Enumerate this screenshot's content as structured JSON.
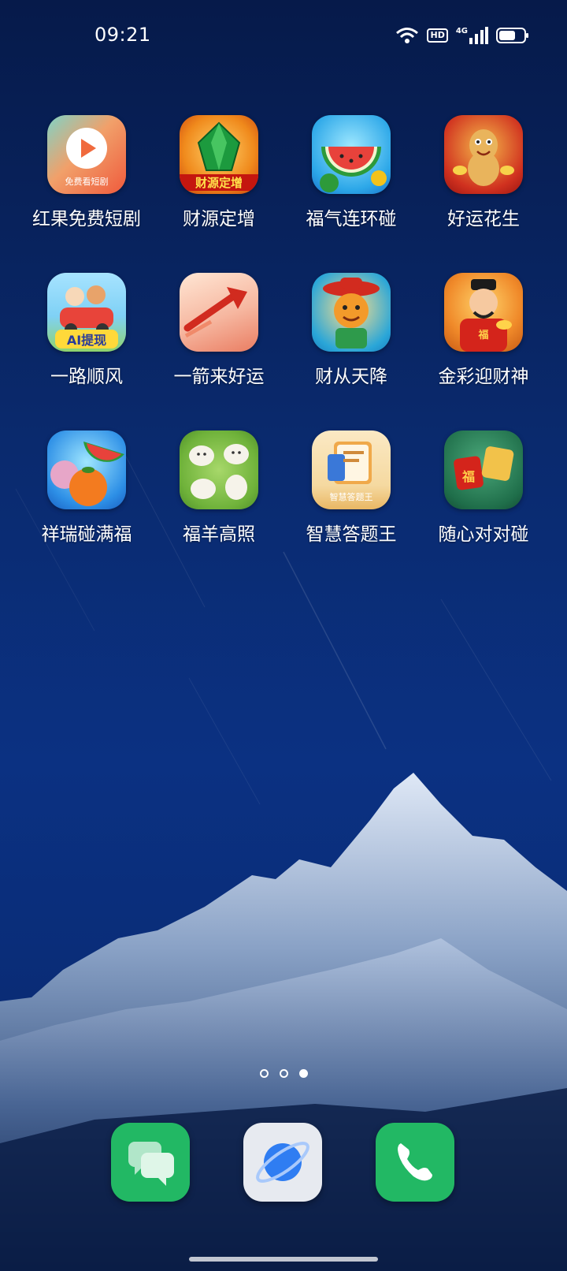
{
  "status_bar": {
    "time": "09:21",
    "hd": "HD",
    "network": "4G",
    "icons": [
      "wifi-icon",
      "hd-icon",
      "signal-icon",
      "battery-icon"
    ]
  },
  "apps": [
    {
      "label": "红果免费短剧",
      "icon": "hongguo-video-icon",
      "badge": "免费看短剧"
    },
    {
      "label": "财源定增",
      "icon": "emerald-gem-icon",
      "badge": "财源定增"
    },
    {
      "label": "福气连环碰",
      "icon": "watermelon-icon"
    },
    {
      "label": "好运花生",
      "icon": "peanut-mascot-icon"
    },
    {
      "label": "一路顺风",
      "icon": "cartoon-car-icon",
      "badge": "AI提现"
    },
    {
      "label": "一箭来好运",
      "icon": "red-arrow-icon"
    },
    {
      "label": "财从天降",
      "icon": "tiger-god-icon"
    },
    {
      "label": "金彩迎财神",
      "icon": "fortune-god-icon",
      "badge": "福"
    },
    {
      "label": "祥瑞碰满福",
      "icon": "fruit-match-icon"
    },
    {
      "label": "福羊高照",
      "icon": "sheep-icon"
    },
    {
      "label": "智慧答题王",
      "icon": "quiz-book-icon",
      "badge": "智慧答题王"
    },
    {
      "label": "随心对对碰",
      "icon": "fu-tiles-icon",
      "badge": "福"
    }
  ],
  "pager": {
    "total": 3,
    "active": 3
  },
  "dock": [
    {
      "name": "messages",
      "icon": "message-bubbles-icon"
    },
    {
      "name": "browser",
      "icon": "planet-browser-icon"
    },
    {
      "name": "phone",
      "icon": "phone-handset-icon"
    }
  ],
  "colors": {
    "wallpaper_top": "#061a4a",
    "wallpaper_mid": "#0b3182",
    "mountain": "#c9d6ea",
    "dock_green": "#22b864"
  }
}
